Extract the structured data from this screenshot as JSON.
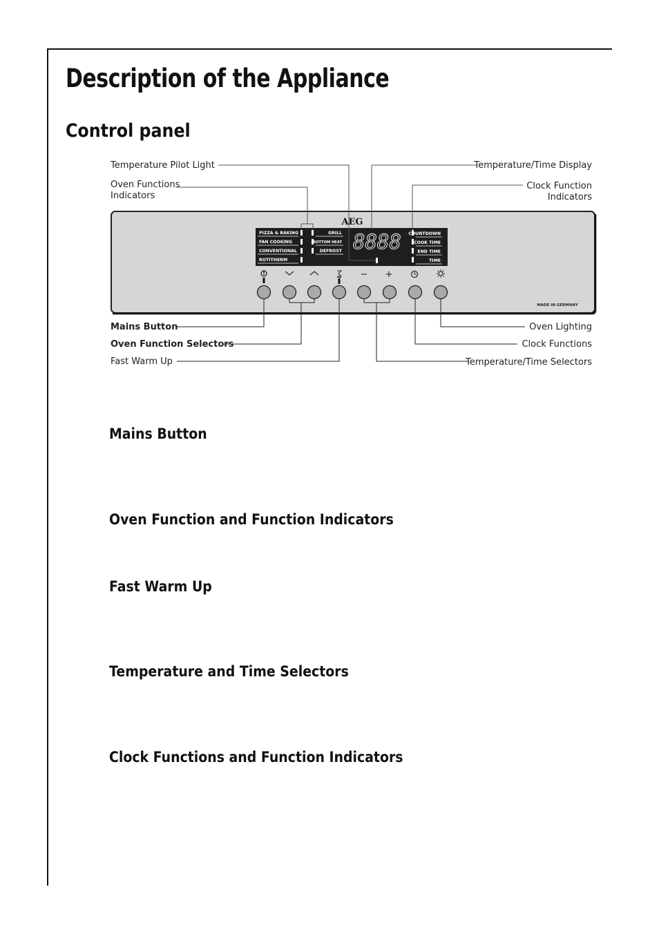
{
  "page": {
    "title": "Description of the Appliance",
    "section_title": "Control panel"
  },
  "diagram": {
    "brand": "AEG",
    "display_value": "8888",
    "made_in": "MADE IN GERMANY",
    "callouts_top": {
      "temperature_pilot_light": "Temperature Pilot Light",
      "oven_functions_indicators_line1": "Oven Functions",
      "oven_functions_indicators_line2": "Indicators",
      "temperature_time_display": "Temperature/Time Display",
      "clock_function_indicators_line1": "Clock Function",
      "clock_function_indicators_line2": "Indicators"
    },
    "callouts_bottom": {
      "mains_button": "Mains Button",
      "oven_function_selectors": "Oven Function Selectors",
      "fast_warm_up": "Fast Warm Up",
      "oven_lighting": "Oven Lighting",
      "clock_functions": "Clock Functions",
      "temperature_time_selectors": "Temperature/Time Selectors"
    },
    "oven_functions_left": [
      "PIZZA & BAKING",
      "FAN COOKING",
      "CONVENTIONAL",
      "ROTITHERM"
    ],
    "oven_functions_right": [
      "GRILL",
      "BOTTOM HEAT",
      "DEFROST"
    ],
    "clock_functions": [
      "COUNTDOWN",
      "COOK TIME",
      "END TIME",
      "TIME"
    ],
    "buttons": [
      {
        "name": "mains",
        "symbol": "power-icon"
      },
      {
        "name": "function-down",
        "symbol": "chevron-down-icon"
      },
      {
        "name": "function-up",
        "symbol": "chevron-up-icon"
      },
      {
        "name": "fast-warm-up",
        "symbol": "fast-warm-up-icon"
      },
      {
        "name": "minus",
        "symbol": "minus-icon",
        "glyph": "−"
      },
      {
        "name": "plus",
        "symbol": "plus-icon",
        "glyph": "+"
      },
      {
        "name": "clock",
        "symbol": "clock-icon"
      },
      {
        "name": "oven-light",
        "symbol": "light-icon"
      }
    ],
    "colors": {
      "panel": "#d6d6d6",
      "display": "#1e1e1e",
      "button": "#a9a9a9"
    }
  },
  "subsections": [
    "Mains Button",
    "Oven Function and Function Indicators",
    "Fast Warm Up",
    "Temperature and Time Selectors",
    "Clock Functions and Function Indicators"
  ]
}
